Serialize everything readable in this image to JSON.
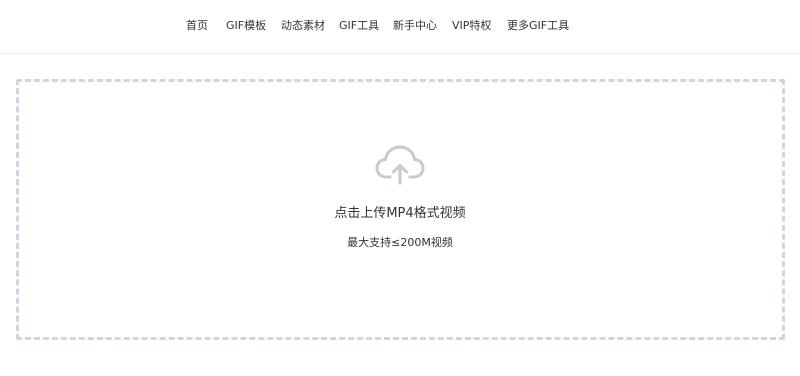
{
  "nav": {
    "items": [
      {
        "label": "首页"
      },
      {
        "label": "GIF模板"
      },
      {
        "label": "动态素材"
      },
      {
        "label": "GIF工具"
      },
      {
        "label": "新手中心"
      },
      {
        "label": "VIP特权"
      },
      {
        "label": "更多GIF工具"
      }
    ]
  },
  "upload": {
    "icon": "cloud-upload-icon",
    "title": "点击上传MP4格式视频",
    "subtitle": "最大支持≤200M视频",
    "border_color": "#cfd6df",
    "icon_color": "#c3cbd5"
  }
}
